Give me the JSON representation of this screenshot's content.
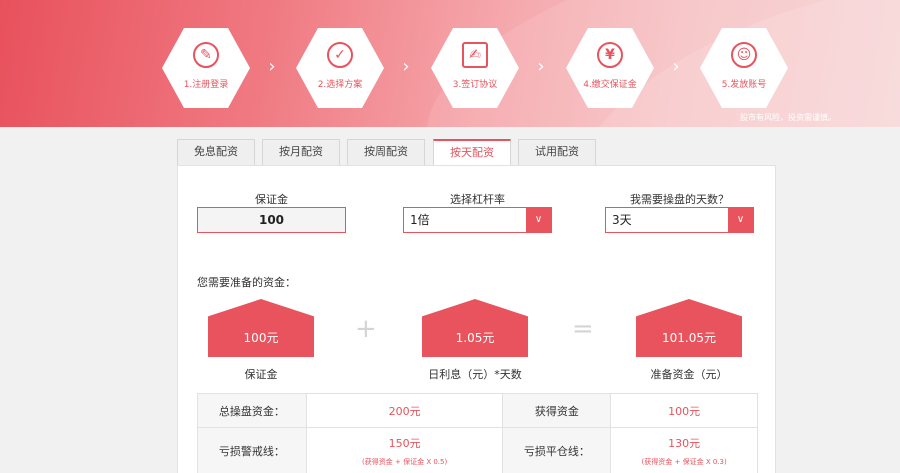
{
  "banner": {
    "steps": [
      {
        "label": "1.注册登录",
        "icon": "✎"
      },
      {
        "label": "2.选择方案",
        "icon": "✓"
      },
      {
        "label": "3.签订协议",
        "icon": "✍"
      },
      {
        "label": "4.缴交保证金",
        "icon": "¥"
      },
      {
        "label": "5.发放账号",
        "icon": "☺"
      }
    ],
    "arrow": "›",
    "risk_notice": "股市有风险，投资需谨慎。"
  },
  "tabs": [
    {
      "label": "免息配资",
      "active": false
    },
    {
      "label": "按月配资",
      "active": false
    },
    {
      "label": "按周配资",
      "active": false
    },
    {
      "label": "按天配资",
      "active": true
    },
    {
      "label": "试用配资",
      "active": false
    }
  ],
  "form": {
    "deposit_label": "保证金",
    "deposit_value": "100",
    "leverage_label": "选择杠杆率",
    "leverage_value": "1倍",
    "days_label": "我需要操盘的天数？",
    "days_value": "3天",
    "select_caret": "∨"
  },
  "summary": {
    "need_label": "您需要准备的资金：",
    "items": [
      {
        "amount": "100元",
        "caption": "保证金"
      },
      {
        "amount": "1.05元",
        "caption": "日利息（元）*天数"
      },
      {
        "amount": "101.05元",
        "caption": "准备资金（元）"
      }
    ],
    "plus": "+",
    "equals": "="
  },
  "table": {
    "row1": {
      "l1": "总操盘资金：",
      "v1": "200元",
      "l2": "获得资金",
      "v2": "100元"
    },
    "row2": {
      "l1": "亏损警戒线：",
      "v1": "150元",
      "n1": "(获得资金 + 保证金 X 0.5)",
      "l2": "亏损平仓线：",
      "v2": "130元",
      "n2": "(获得资金 + 保证金 X 0.3)"
    }
  },
  "colors": {
    "accent": "#e8535d"
  }
}
